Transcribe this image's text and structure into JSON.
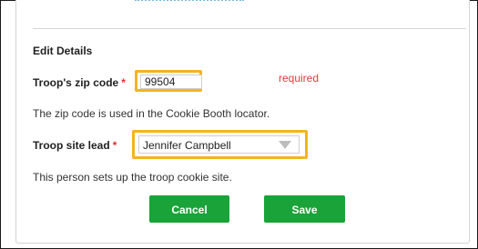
{
  "form": {
    "section_title": "Edit Details",
    "zip": {
      "label": "Troop's zip code",
      "required_marker": "*",
      "value": "99504",
      "required_note": "required",
      "help": "The zip code is used in the Cookie Booth locator."
    },
    "site_lead": {
      "label": "Troop site lead",
      "required_marker": "*",
      "selected": "Jennifer Campbell",
      "help": "This person sets up the troop cookie site."
    },
    "buttons": {
      "cancel": "Cancel",
      "save": "Save"
    }
  },
  "colors": {
    "button_green": "#1aa338",
    "highlight_yellow": "#f2b51c",
    "required_red": "#e23b3b"
  }
}
